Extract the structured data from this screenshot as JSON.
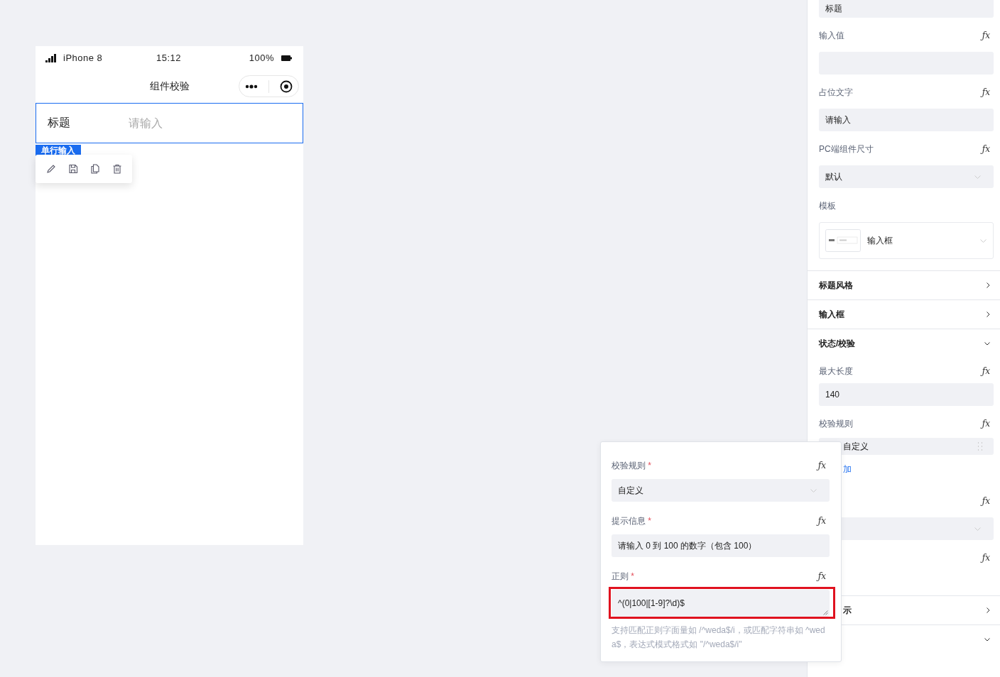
{
  "phone": {
    "status_bar": {
      "carrier": "iPhone 8",
      "time": "15:12",
      "battery": "100%"
    },
    "nav_title": "组件校验",
    "form_item": {
      "label": "标题",
      "placeholder": "请输入",
      "selected": true
    },
    "component_tag": "单行输入"
  },
  "panel": {
    "top_value": "标题",
    "props": [
      {
        "label": "输入值",
        "fx": "ƒx",
        "kind": "input"
      },
      {
        "label": "占位文字",
        "fx": "ƒx",
        "kind": "input",
        "value": "请输入"
      },
      {
        "label": "PC端组件尺寸",
        "fx": "ƒx",
        "kind": "select",
        "value": "默认"
      },
      {
        "label": "模板",
        "kind": "template",
        "value": "输入框"
      }
    ],
    "sections": [
      {
        "title": "标题风格",
        "expanded": false
      },
      {
        "title": "输入框",
        "expanded": false
      },
      {
        "title": "状态/校验",
        "expanded": true
      }
    ],
    "max_length": {
      "label": "最大长度",
      "fx": "ƒx",
      "value": "140"
    },
    "rules": {
      "label": "校验规则",
      "fx": "ƒx",
      "items": [
        "自定义"
      ],
      "add_link": "加"
    },
    "covered_props": [
      {
        "fx": "ƒx",
        "kind": "select"
      },
      {
        "fx": "ƒx",
        "kind": "blank"
      }
    ],
    "lower_sections": [
      {
        "title": "示",
        "expanded": false
      },
      {
        "expanded": true
      }
    ]
  },
  "popup": {
    "fields": [
      {
        "label": "校验规则",
        "required_mark": "*",
        "fx": "ƒx",
        "kind": "select",
        "value": "自定义",
        "highlighted": false
      },
      {
        "label": "提示信息",
        "required_mark": "*",
        "fx": "ƒx",
        "kind": "input",
        "value": "请输入 0 到 100 的数字（包含 100）",
        "highlighted": false
      },
      {
        "label": "正则",
        "required_mark": "*",
        "fx": "ƒx",
        "kind": "textarea",
        "value": "^(0|100|[1-9]?\\d)$",
        "highlighted": true
      }
    ],
    "help": "支持匹配正则字面量如 /^weda$/i，或匹配字符串如 ^weda$，表达式模式格式如 \"/^weda$/i\""
  }
}
